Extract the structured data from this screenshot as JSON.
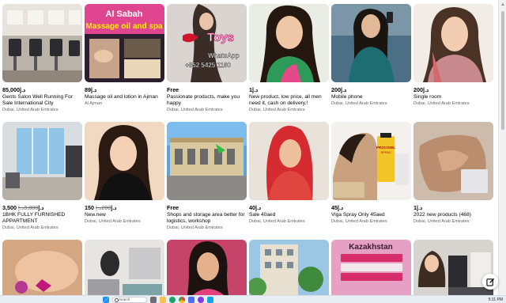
{
  "listings": [
    {
      "price": "85,000د.إ",
      "old_price": "",
      "title": "Gents Salon Well Running For Sale International City",
      "location": "Dubai, United Arab Emirates"
    },
    {
      "price": "89د.إ",
      "old_price": "",
      "title": "Massage oil and lotion in Ajman",
      "location": "Al Ajman"
    },
    {
      "price": "Free",
      "old_price": "",
      "title": "Passionate products, make you happy",
      "location": "Dubai, United Arab Emirates"
    },
    {
      "price": "1د.إ",
      "old_price": "",
      "title": "New product, low price, all men need it, cash on delivery.!",
      "location": "Dubai, United Arab Emirates"
    },
    {
      "price": "200د.إ",
      "old_price": "",
      "title": "Mobile phone",
      "location": "Dubai, United Arab Emirates"
    },
    {
      "price": "200د.إ",
      "old_price": "",
      "title": "Single room",
      "location": "Dubai, United Arab Emirates"
    },
    {
      "price": "3,500د.إ",
      "old_price": "3,800د.إ",
      "title": "1BHK FULLY FURNISHED APPARTMENT",
      "location": "Dubai, United Arab Emirates"
    },
    {
      "price": "150د.إ",
      "old_price": "200د.إ",
      "title": "New.new",
      "location": "Dubai, United Arab Emirates"
    },
    {
      "price": "Free",
      "old_price": "",
      "title": "Shops and storage area better for logistics, workshop",
      "location": "Dubai, United Arab Emirates"
    },
    {
      "price": "40د.إ",
      "old_price": "",
      "title": "Sale 40aed",
      "location": "Dubai, United Arab Emirates"
    },
    {
      "price": "45د.إ",
      "old_price": "",
      "title": "Viga Spray Only 45aed",
      "location": "Dubai, United Arab Emirates"
    },
    {
      "price": "1د.إ",
      "old_price": "",
      "title": "2022 new products (468)",
      "location": "Dubai, United Arab Emirates"
    },
    {
      "price": "",
      "old_price": "",
      "title": "",
      "location": ""
    },
    {
      "price": "",
      "old_price": "",
      "title": "",
      "location": ""
    },
    {
      "price": "",
      "old_price": "",
      "title": "",
      "location": ""
    },
    {
      "price": "",
      "old_price": "",
      "title": "",
      "location": ""
    },
    {
      "price": "",
      "old_price": "",
      "title": "",
      "location": ""
    },
    {
      "price": "",
      "old_price": "",
      "title": "",
      "location": ""
    }
  ],
  "image_text": {
    "massage_line1": "Al Sabah",
    "massage_line2": "Massage oil and spa",
    "toys": "Toys",
    "whatsapp": "WhatsApp",
    "phone": "+852 5425 1160",
    "procomil_brand": "PROCOMIL",
    "procomil_sub": "SPRAY",
    "kazakhstan": "Kazakhstan"
  },
  "taskbar": {
    "search_label": "Search",
    "time": "5:11 PM"
  },
  "colors": {
    "price_text": "#050505",
    "secondary_text": "#65676b",
    "taskbar_bg": "#e9eef5"
  },
  "icons": [
    "compose-icon",
    "search-icon",
    "windows-start-icon",
    "scroll-up-icon"
  ]
}
